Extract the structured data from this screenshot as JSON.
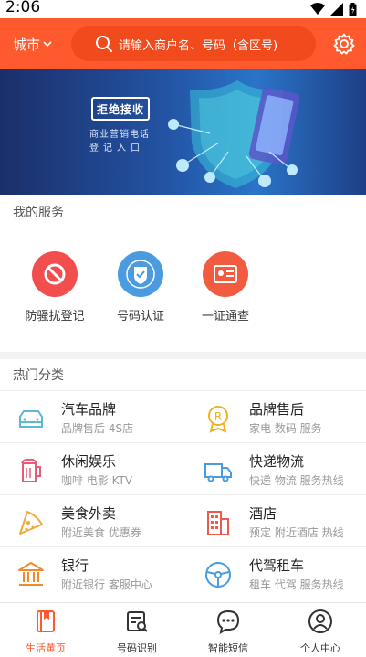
{
  "status_bar": {
    "time": "2:06"
  },
  "header": {
    "city_label": "城市",
    "search_placeholder": "请输入商户名、号码（含区号)"
  },
  "banner": {
    "badge": "拒绝接收",
    "line1": "商业营销电话",
    "line2": "登记入口"
  },
  "services": {
    "title": "我的服务",
    "items": [
      {
        "label": "防骚扰登记",
        "icon": "no-entry-icon",
        "color": "#f24e4e"
      },
      {
        "label": "号码认证",
        "icon": "verified-badge-icon",
        "color": "#4a9be0"
      },
      {
        "label": "一证通查",
        "icon": "id-card-icon",
        "color": "#f25b3f"
      }
    ]
  },
  "hot_categories": {
    "title": "热门分类",
    "items": [
      {
        "title": "汽车品牌",
        "sub": "品牌售后 4S店",
        "icon": "car-icon"
      },
      {
        "title": "品牌售后",
        "sub": "家电 数码 服务",
        "icon": "medal-icon"
      },
      {
        "title": "休闲娱乐",
        "sub": "咖啡 电影 KTV",
        "icon": "beer-icon"
      },
      {
        "title": "快递物流",
        "sub": "快递 物流 服务热线",
        "icon": "truck-icon"
      },
      {
        "title": "美食外卖",
        "sub": "附近美食 优惠券",
        "icon": "pizza-icon"
      },
      {
        "title": "酒店",
        "sub": "预定 附近酒店 热线",
        "icon": "hotel-icon"
      },
      {
        "title": "银行",
        "sub": "附近银行 客服中心",
        "icon": "bank-icon"
      },
      {
        "title": "代驾租车",
        "sub": "租车 代驾 服务热线",
        "icon": "steering-wheel-icon"
      }
    ]
  },
  "tabs": [
    {
      "label": "生活黄页",
      "icon": "yellow-pages-icon",
      "active": true
    },
    {
      "label": "号码识别",
      "icon": "number-scan-icon",
      "active": false
    },
    {
      "label": "智能短信",
      "icon": "sms-icon",
      "active": false
    },
    {
      "label": "个人中心",
      "icon": "user-icon",
      "active": false
    }
  ],
  "colors": {
    "brand": "#ff5a2e",
    "accent_active": "#ff5a2e"
  }
}
